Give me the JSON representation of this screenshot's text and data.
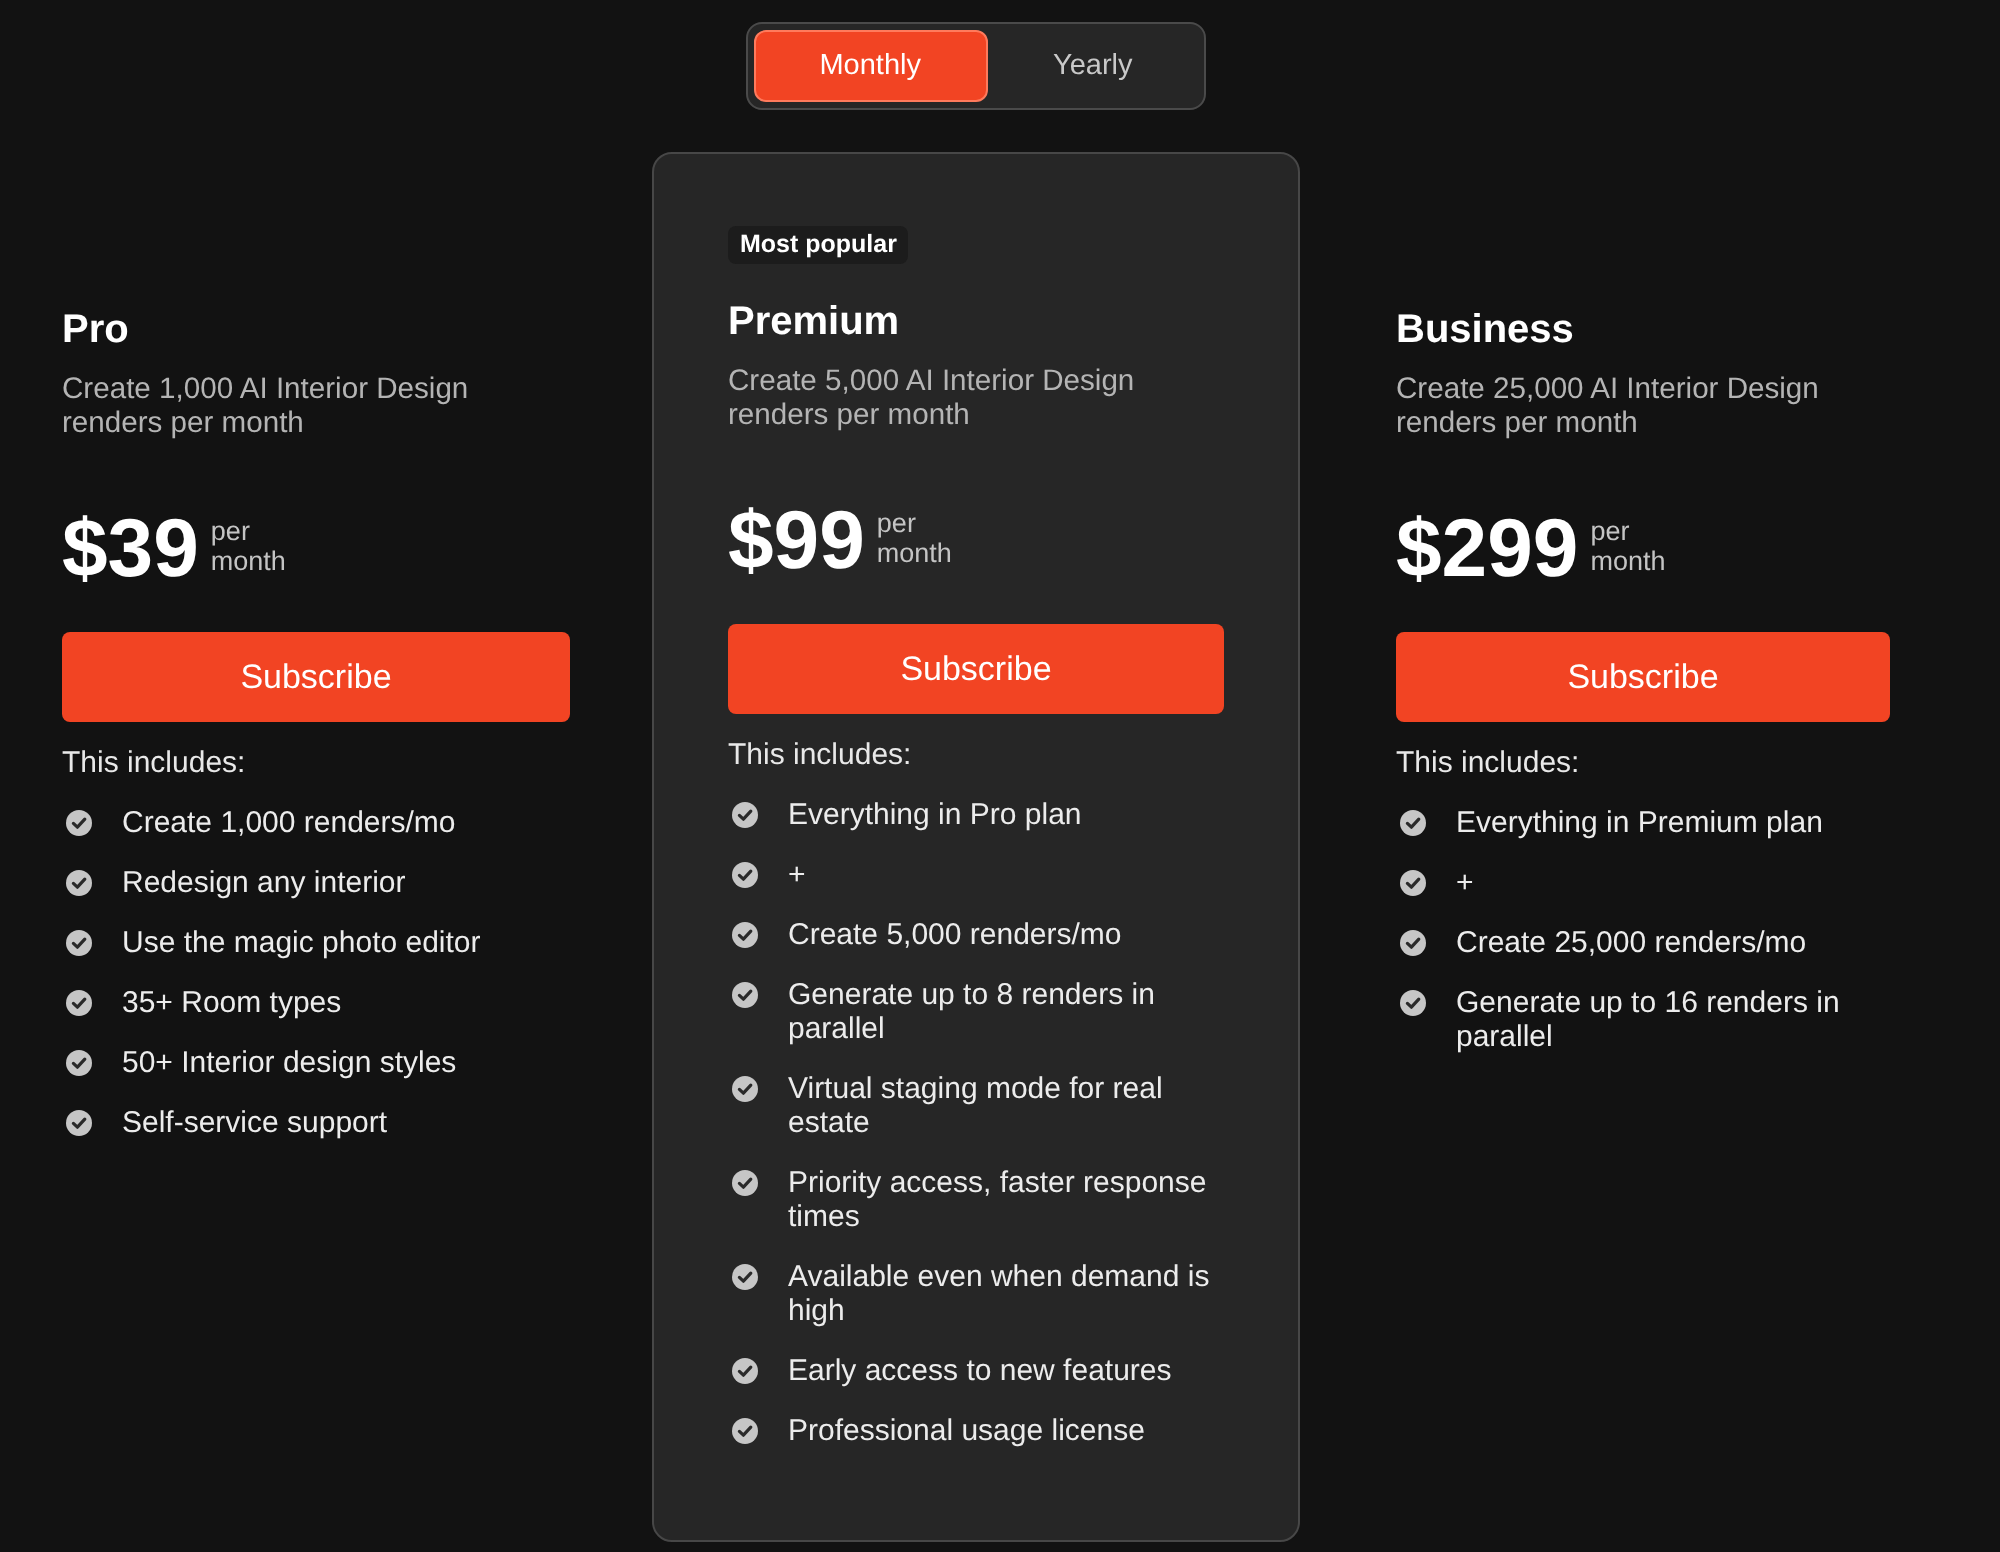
{
  "billing_toggle": [
    {
      "label": "Monthly",
      "selected": true
    },
    {
      "label": "Yearly",
      "selected": false
    }
  ],
  "plans": [
    {
      "name": "Pro",
      "featured": false,
      "description": "Create 1,000 AI Interior Design renders per month",
      "price": "$39",
      "period": "per month",
      "button": "Subscribe",
      "includes_label": "This includes:",
      "features": [
        "Create 1,000 renders/mo",
        "Redesign any interior",
        "Use the magic photo editor",
        "35+ Room types",
        "50+ Interior design styles",
        "Self-service support"
      ]
    },
    {
      "name": "Premium",
      "featured": true,
      "badge": "Most popular",
      "description": "Create 5,000 AI Interior Design renders per month",
      "price": "$99",
      "period": "per month",
      "button": "Subscribe",
      "includes_label": "This includes:",
      "features": [
        "Everything in Pro plan",
        "+",
        "Create 5,000 renders/mo",
        "Generate up to 8 renders in parallel",
        "Virtual staging mode for real estate",
        "Priority access, faster response times",
        "Available even when demand is high",
        "Early access to new features",
        "Professional usage license"
      ]
    },
    {
      "name": "Business",
      "featured": false,
      "description": "Create 25,000 AI Interior Design renders per month",
      "price": "$299",
      "period": "per month",
      "button": "Subscribe",
      "includes_label": "This includes:",
      "features": [
        "Everything in Premium plan",
        "+",
        "Create 25,000 renders/mo",
        "Generate up to 16 renders in parallel"
      ]
    }
  ]
}
